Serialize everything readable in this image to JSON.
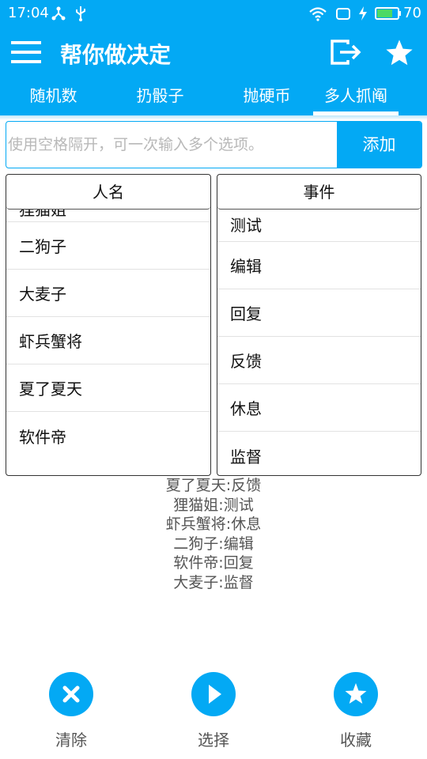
{
  "status_bar": {
    "time": "17:04",
    "battery_percent": "70",
    "icons": [
      "share-icon",
      "usb-icon",
      "wifi-icon",
      "notification-icon",
      "charging-icon",
      "battery-icon"
    ]
  },
  "app_bar": {
    "title": "帮你做决定",
    "accent_color": "#03a9f4",
    "icons": [
      "menu-icon",
      "exit-icon",
      "star-icon"
    ]
  },
  "tabs": [
    {
      "label": "随机数",
      "active": false
    },
    {
      "label": "扔骰子",
      "active": false
    },
    {
      "label": "抛硬币",
      "active": false
    },
    {
      "label": "多人抓阄",
      "active": true
    }
  ],
  "input": {
    "placeholder": "使用空格隔开，可一次输入多个选项。",
    "value": "",
    "add_label": "添加"
  },
  "names_panel": {
    "header": "人名",
    "items": [
      "狸猫姐",
      "二狗子",
      "大麦子",
      "虾兵蟹将",
      "夏了夏天",
      "软件帝"
    ]
  },
  "events_panel": {
    "header": "事件",
    "items": [
      "测试",
      "编辑",
      "回复",
      "反馈",
      "休息",
      "监督"
    ]
  },
  "results": [
    "夏了夏天:反馈",
    "狸猫姐:测试",
    "虾兵蟹将:休息",
    "二狗子:编辑",
    "软件帝:回复",
    "大麦子:监督"
  ],
  "bottom_actions": [
    {
      "label": "清除",
      "icon": "close-icon"
    },
    {
      "label": "选择",
      "icon": "play-icon"
    },
    {
      "label": "收藏",
      "icon": "star-icon"
    }
  ]
}
